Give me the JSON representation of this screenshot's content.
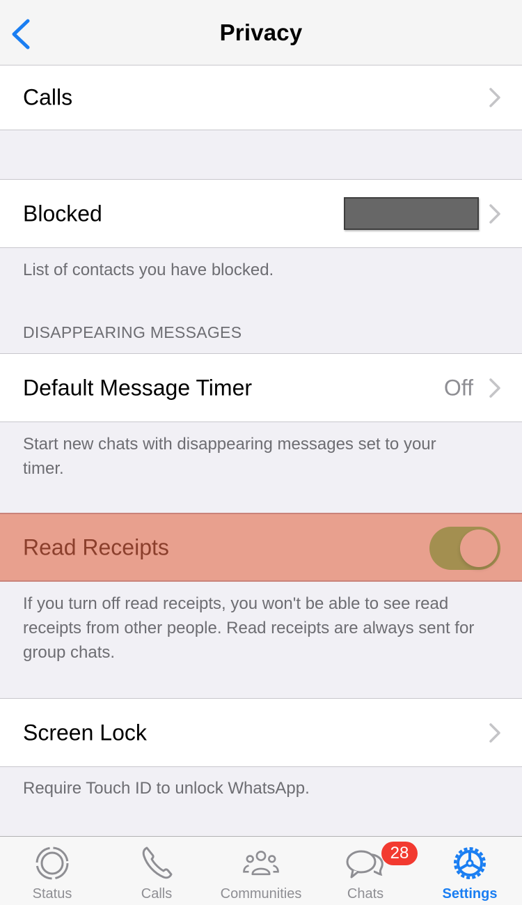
{
  "nav": {
    "title": "Privacy",
    "back_icon": "chevron-left-icon",
    "accent_color": "#1a7ef2"
  },
  "rows": {
    "calls": {
      "label": "Calls"
    },
    "blocked": {
      "label": "Blocked",
      "value_redacted": true,
      "footer": "List of contacts you have blocked."
    },
    "disappearing": {
      "section_header": "DISAPPEARING MESSAGES",
      "label": "Default Message Timer",
      "value": "Off",
      "footer": "Start new chats with disappearing messages set to your timer."
    },
    "read_receipts": {
      "label": "Read Receipts",
      "enabled": true,
      "highlighted": true,
      "footer": "If you turn off read receipts, you won't be able to see read receipts from other people. Read receipts are always sent for group chats."
    },
    "screen_lock": {
      "label": "Screen Lock",
      "footer": "Require Touch ID to unlock WhatsApp."
    }
  },
  "tabbar": {
    "tabs": [
      {
        "label": "Status",
        "icon": "status-icon",
        "active": false
      },
      {
        "label": "Calls",
        "icon": "phone-icon",
        "active": false
      },
      {
        "label": "Communities",
        "icon": "communities-icon",
        "active": false
      },
      {
        "label": "Chats",
        "icon": "chats-icon",
        "active": false,
        "badge": "28"
      },
      {
        "label": "Settings",
        "icon": "settings-gear-icon",
        "active": true
      }
    ],
    "badge_color": "#f23a30"
  }
}
